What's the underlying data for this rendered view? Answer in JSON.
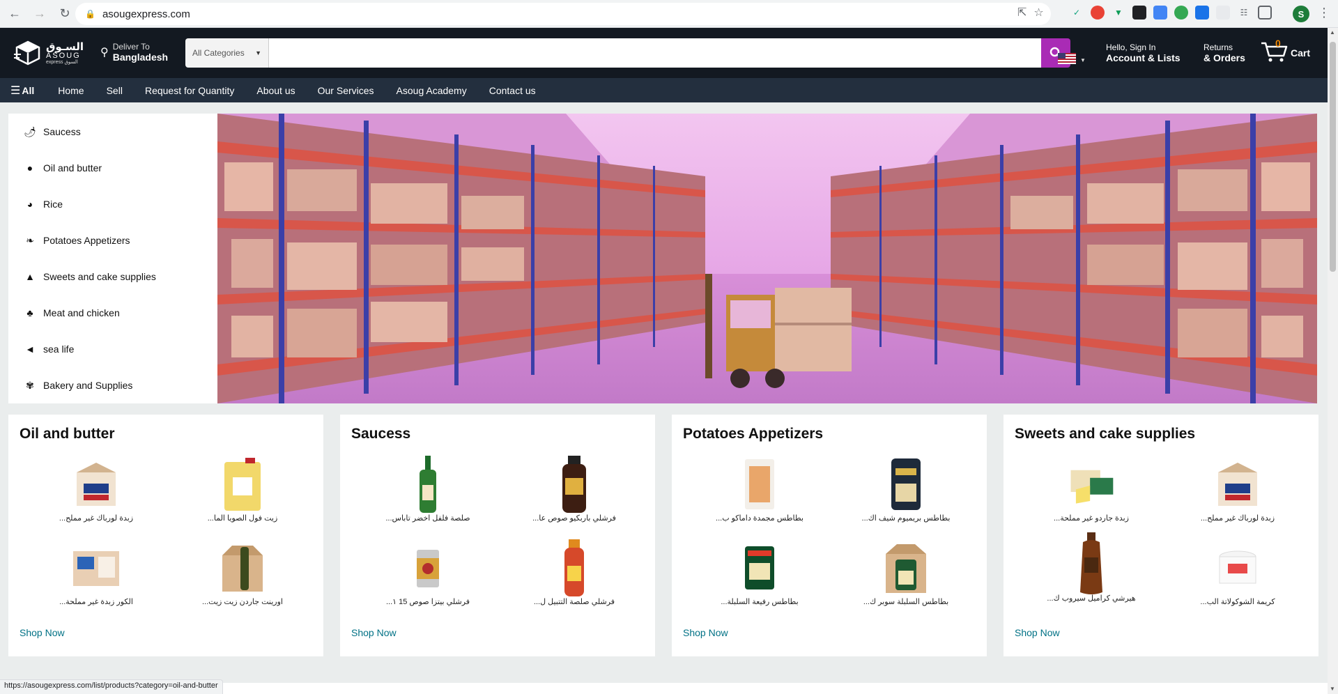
{
  "browser": {
    "url": "asougexpress.com",
    "status_url": "https://asougexpress.com/list/products?category=oil-and-butter",
    "profile_initial": "S"
  },
  "header": {
    "logo_ar": "السـوق",
    "logo_en": "ASOUG",
    "logo_sub": "express السوق",
    "deliver_small": "Deliver To",
    "deliver_big": "Bangladesh",
    "search_category": "All Categories",
    "search_placeholder": "",
    "account_small": "Hello, Sign In",
    "account_big": "Account & Lists",
    "returns_small": "Returns",
    "returns_big": "& Orders",
    "cart_count": "0",
    "cart_label": "Cart",
    "brand_color": "#a92bb5"
  },
  "navbar": {
    "all_label": "All",
    "links": [
      "Home",
      "Sell",
      "Request for Quantity",
      "About us",
      "Our Services",
      "Asoug Academy",
      "Contact us"
    ]
  },
  "sidebar": {
    "items": [
      {
        "label": "Saucess",
        "icon": "sauce-bottle-icon"
      },
      {
        "label": "Oil and butter",
        "icon": "oil-can-icon"
      },
      {
        "label": "Rice",
        "icon": "rice-bowl-icon"
      },
      {
        "label": "Potatoes Appetizers",
        "icon": "pepper-icon"
      },
      {
        "label": "Sweets and cake supplies",
        "icon": "cake-icon"
      },
      {
        "label": "Meat and chicken",
        "icon": "meat-icon"
      },
      {
        "label": "sea life",
        "icon": "fish-icon"
      },
      {
        "label": "Bakery and Supplies",
        "icon": "bread-icon"
      }
    ]
  },
  "cards": [
    {
      "title": "Oil and butter",
      "shop_now": "Shop Now",
      "products": [
        "...زبدة لورباك غير مملح",
        "...زيت فول الصويا الما",
        "...الكور زبدة غير مملحة",
        "...اورينت جاردن زيت زيت"
      ]
    },
    {
      "title": "Saucess",
      "shop_now": "Shop Now",
      "products": [
        "...صلصة فلفل اخضر تاباس",
        "...فرشلي باربكيو صوص عا",
        "...فرشلي بيتزا صوص 15 ١",
        "...فرشلي صلصة التتبيل ل"
      ]
    },
    {
      "title": "Potatoes Appetizers",
      "shop_now": "Shop Now",
      "products": [
        "...بطاطس مجمدة داماكو ب",
        "...بطاطس بريميوم شيف اك",
        "...بطاطس رفيعة السلبلة",
        "...بطاطس السلبلة سوبر ك"
      ]
    },
    {
      "title": "Sweets and cake supplies",
      "shop_now": "Shop Now",
      "products": [
        "...زبدة جاردو غير مملحة",
        "...زبدة لورباك غير مملح",
        "...هيرشي كراميل سيروب ك",
        "...كريمة الشوكولاتة الب"
      ]
    }
  ]
}
